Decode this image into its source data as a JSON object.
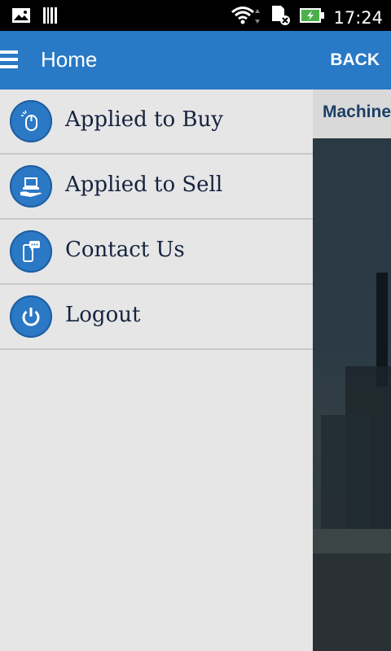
{
  "status_bar": {
    "time": "17:24"
  },
  "app_bar": {
    "title": "Home",
    "back_label": "BACK"
  },
  "content": {
    "tab_label": "Machine"
  },
  "drawer": {
    "items": [
      {
        "label": "Applied to Buy",
        "icon": "mouse-icon"
      },
      {
        "label": "Applied to Sell",
        "icon": "laptop-hand-icon"
      },
      {
        "label": "Contact Us",
        "icon": "phone-chat-icon"
      },
      {
        "label": "Logout",
        "icon": "power-icon"
      }
    ]
  },
  "colors": {
    "app_bar": "#2879c6",
    "drawer_bg": "#e6e6e6",
    "icon_circle": "#2b78c5",
    "label_text": "#16233f"
  }
}
